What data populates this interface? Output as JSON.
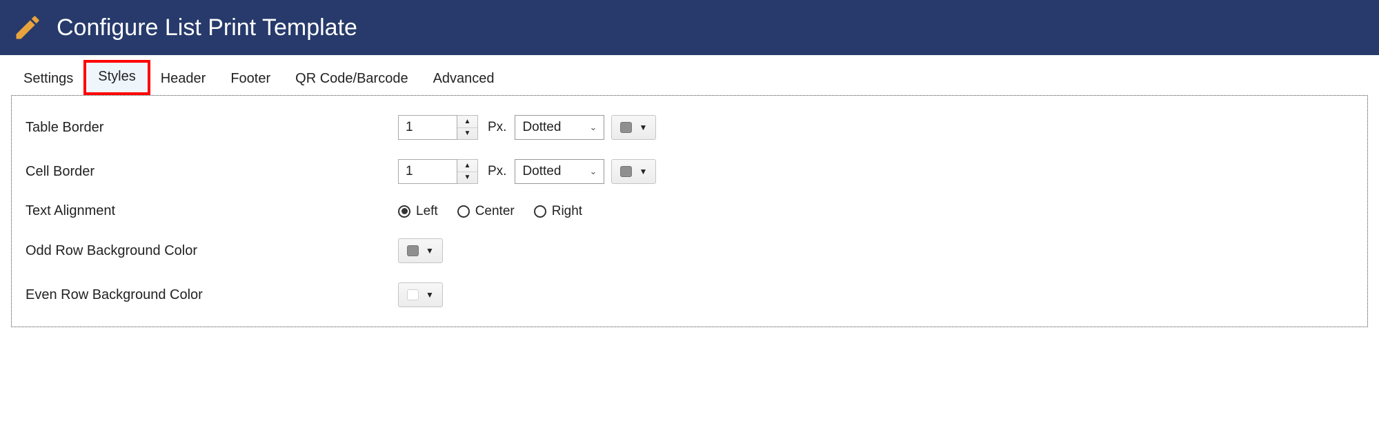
{
  "header": {
    "title": "Configure List Print Template"
  },
  "tabs": [
    {
      "label": "Settings",
      "active": false
    },
    {
      "label": "Styles",
      "active": true
    },
    {
      "label": "Header",
      "active": false
    },
    {
      "label": "Footer",
      "active": false
    },
    {
      "label": "QR Code/Barcode",
      "active": false
    },
    {
      "label": "Advanced",
      "active": false
    }
  ],
  "labels": {
    "table_border": "Table Border",
    "cell_border": "Cell Border",
    "text_alignment": "Text Alignment",
    "odd_row_bg": "Odd Row Background Color",
    "even_row_bg": "Even Row Background Color",
    "px_unit": "Px."
  },
  "values": {
    "table_border_value": "1",
    "table_border_style": "Dotted",
    "cell_border_value": "1",
    "cell_border_style": "Dotted"
  },
  "alignment_options": {
    "left": "Left",
    "center": "Center",
    "right": "Right",
    "selected": "left"
  }
}
